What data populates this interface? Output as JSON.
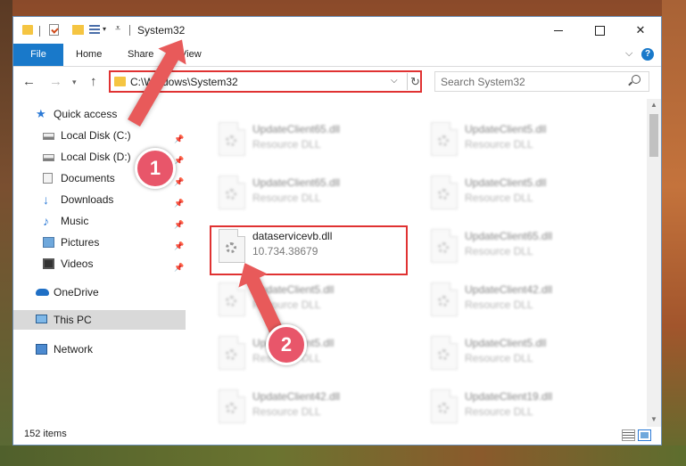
{
  "window": {
    "title": "System32",
    "controls": {
      "minimize": "",
      "maximize": "",
      "close": "✕"
    }
  },
  "ribbon": {
    "tabs": [
      "File",
      "Home",
      "Share",
      "View"
    ],
    "help": "?"
  },
  "address": {
    "path": "C:\\Windows\\System32",
    "search_placeholder": "Search System32"
  },
  "nav": {
    "items": [
      {
        "label": "Quick access",
        "icon": "star-icon",
        "pinned": false
      },
      {
        "label": "Local Disk (C:)",
        "icon": "drive-icon",
        "pinned": true
      },
      {
        "label": "Local Disk (D:)",
        "icon": "drive-icon",
        "pinned": true
      },
      {
        "label": "Documents",
        "icon": "documents-icon",
        "pinned": true
      },
      {
        "label": "Downloads",
        "icon": "download-icon",
        "pinned": true
      },
      {
        "label": "Music",
        "icon": "music-icon",
        "pinned": true
      },
      {
        "label": "Pictures",
        "icon": "pictures-icon",
        "pinned": true
      },
      {
        "label": "Videos",
        "icon": "videos-icon",
        "pinned": true
      },
      {
        "label": "OneDrive",
        "icon": "cloud-icon",
        "pinned": false
      },
      {
        "label": "This PC",
        "icon": "computer-icon",
        "pinned": false
      },
      {
        "label": "Network",
        "icon": "network-icon",
        "pinned": false
      }
    ]
  },
  "files": [
    {
      "name": "UpdateClient65.dll",
      "desc": "Resource DLL"
    },
    {
      "name": "UpdateClient5.dll",
      "desc": "Resource DLL"
    },
    {
      "name": "UpdateClient65.dll",
      "desc": "Resource DLL"
    },
    {
      "name": "UpdateClient5.dll",
      "desc": "Resource DLL"
    },
    {
      "name": "dataservicevb.dll",
      "desc": "10.734.38679"
    },
    {
      "name": "UpdateClient65.dll",
      "desc": "Resource DLL"
    },
    {
      "name": "UpdateClient5.dll",
      "desc": "Resource DLL"
    },
    {
      "name": "UpdateClient42.dll",
      "desc": "Resource DLL"
    },
    {
      "name": "UpdateClient5.dll",
      "desc": "Resource DLL"
    },
    {
      "name": "UpdateClient5.dll",
      "desc": "Resource DLL"
    },
    {
      "name": "UpdateClient42.dll",
      "desc": "Resource DLL"
    },
    {
      "name": "UpdateClient19.dll",
      "desc": "Resource DLL"
    }
  ],
  "status": {
    "count": "152 items"
  },
  "annotations": {
    "step1": "1",
    "step2": "2"
  },
  "colors": {
    "accent": "#1979ca",
    "highlight": "#e03232",
    "badge": "#e8566a"
  }
}
